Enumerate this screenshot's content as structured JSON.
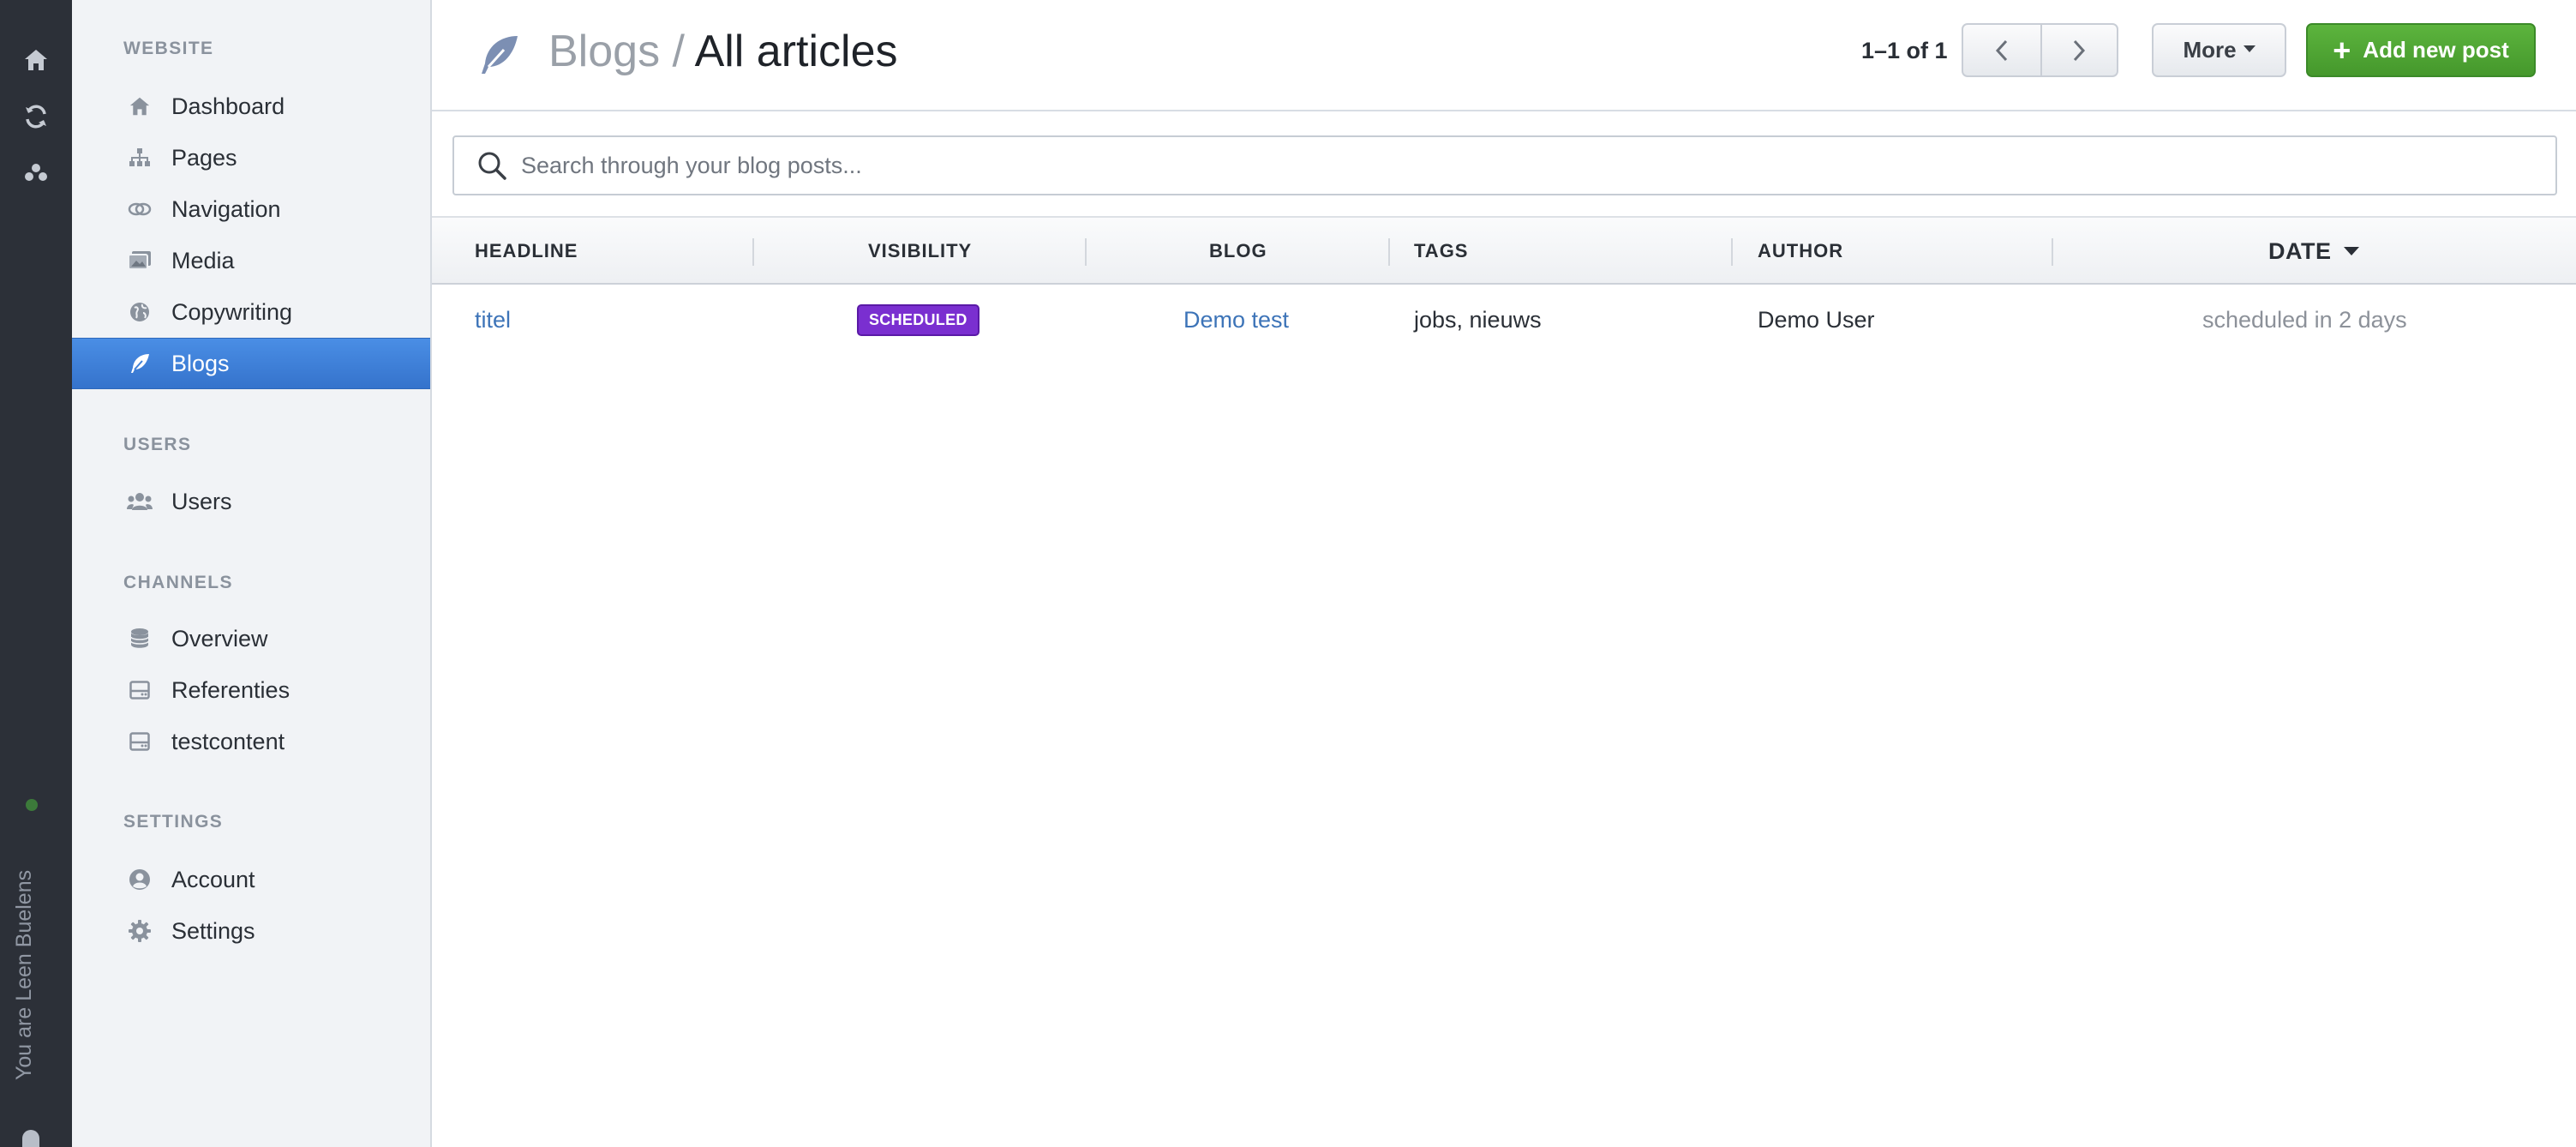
{
  "rail": {
    "user_text": "You are Leen Buelens",
    "icons": [
      "home-icon",
      "sync-icon",
      "users-group-icon"
    ],
    "status_color": "#3c7a3a"
  },
  "sidebar": {
    "sections": [
      {
        "title": "WEBSITE",
        "items": [
          {
            "label": "Dashboard",
            "icon": "home-icon"
          },
          {
            "label": "Pages",
            "icon": "sitemap-icon"
          },
          {
            "label": "Navigation",
            "icon": "link-icon"
          },
          {
            "label": "Media",
            "icon": "images-icon"
          },
          {
            "label": "Copywriting",
            "icon": "globe-icon"
          },
          {
            "label": "Blogs",
            "icon": "feather-icon",
            "active": true
          }
        ]
      },
      {
        "title": "USERS",
        "items": [
          {
            "label": "Users",
            "icon": "users-icon"
          }
        ]
      },
      {
        "title": "CHANNELS",
        "items": [
          {
            "label": "Overview",
            "icon": "database-icon"
          },
          {
            "label": "Referenties",
            "icon": "channel-icon"
          },
          {
            "label": "testcontent",
            "icon": "channel-icon"
          }
        ]
      },
      {
        "title": "SETTINGS",
        "items": [
          {
            "label": "Account",
            "icon": "user-circle-icon"
          },
          {
            "label": "Settings",
            "icon": "gear-icon"
          }
        ]
      }
    ]
  },
  "header": {
    "breadcrumb": "Blogs",
    "separator": "/",
    "title": "All articles",
    "pager_text": "1–1 of 1",
    "more_label": "More",
    "add_label": "Add new post",
    "add_color": "#4fa733"
  },
  "search": {
    "placeholder": "Search through your blog posts...",
    "value": ""
  },
  "table": {
    "columns": [
      "HEADLINE",
      "VISIBILITY",
      "BLOG",
      "TAGS",
      "AUTHOR",
      "DATE"
    ],
    "rows": [
      {
        "headline": "titel",
        "visibility": "SCHEDULED",
        "blog": "Demo test",
        "tags": "jobs, nieuws",
        "author": "Demo User",
        "date": "scheduled in 2 days"
      }
    ],
    "badge_color": "#7a2fd0"
  }
}
